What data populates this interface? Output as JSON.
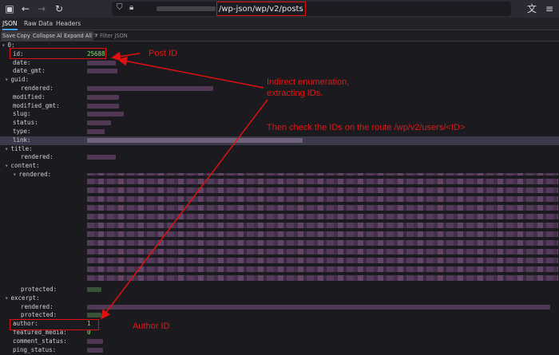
{
  "url": {
    "path": "/wp-json/wp/v2/posts"
  },
  "tabs": [
    "JSON",
    "Raw Data",
    "Headers"
  ],
  "toolbar": {
    "save": "Save",
    "copy": "Copy",
    "collapse": "Collapse All",
    "expand": "Expand All",
    "filter": "Filter JSON"
  },
  "tree": {
    "root": "0:",
    "keys": {
      "id": "id:",
      "date": "date:",
      "date_gmt": "date_gmt:",
      "guid": "guid:",
      "rendered": "rendered:",
      "modified": "modified:",
      "modified_gmt": "modified_gmt:",
      "slug": "slug:",
      "status": "status:",
      "type": "type:",
      "link": "link:",
      "title": "title:",
      "content": "content:",
      "protected": "protected:",
      "excerpt": "excerpt:",
      "author": "author:",
      "featured_media": "featured_media:",
      "comment_status": "comment_status:",
      "ping_status": "ping_status:"
    },
    "id_value": "25688",
    "author_value": "1",
    "featured_media_value": "0"
  },
  "annotations": {
    "post_id": "Post ID",
    "indirect": "Indirect enumeration,",
    "extracting": "extracting IDs.",
    "then": "Then check the IDs on the route /wp/v2/users/<ID>",
    "author_id": "Author ID"
  },
  "colors": {
    "annotation": "#e01010",
    "accent": "#45a1ff"
  }
}
